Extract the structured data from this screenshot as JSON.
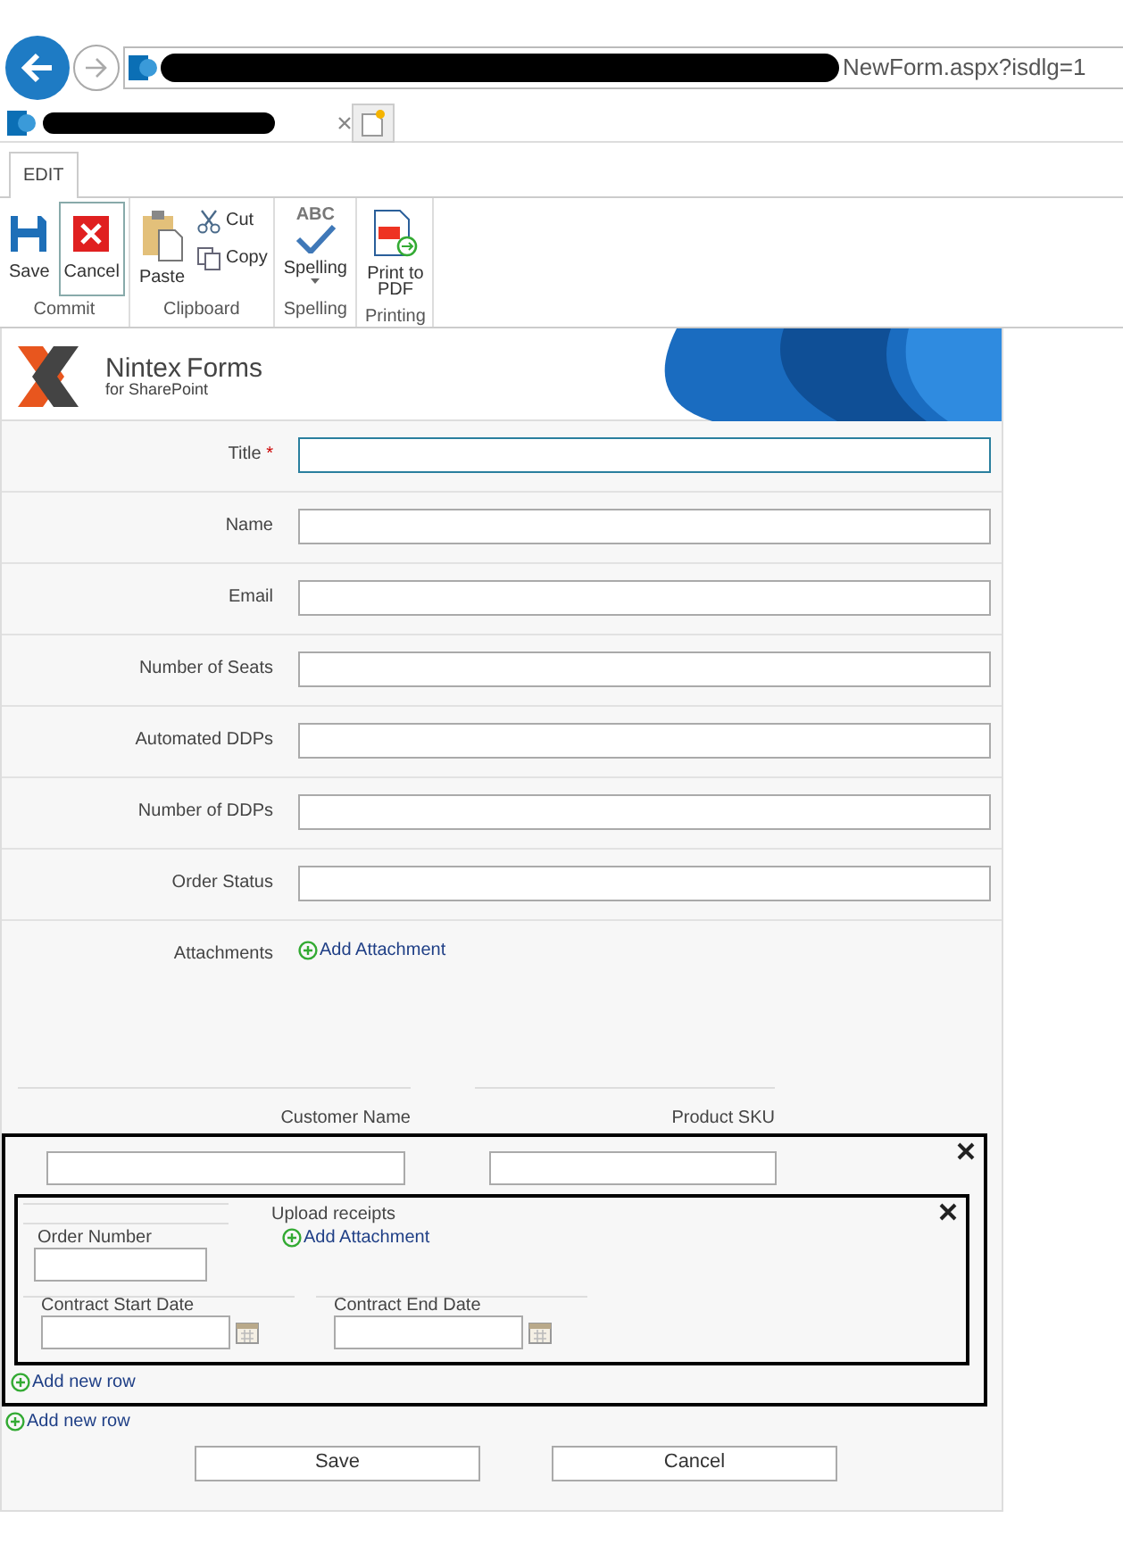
{
  "address_bar": {
    "url": "NewForm.aspx?isdlg=1"
  },
  "ribbon": {
    "tabs": [
      {
        "label": "EDIT",
        "selected": true
      }
    ],
    "groups": [
      {
        "label": "Commit",
        "buttons": [
          {
            "kind": "save",
            "label": "Save",
            "selected": false
          },
          {
            "kind": "cancel",
            "label": "Cancel",
            "selected": true
          }
        ]
      },
      {
        "label": "Clipboard",
        "buttons": [
          {
            "kind": "paste",
            "label": "Paste",
            "selected": false
          },
          {
            "kind": "cut",
            "label": "Cut",
            "selected": false
          },
          {
            "kind": "copy",
            "label": "Copy",
            "selected": false
          }
        ]
      },
      {
        "label": "Spelling",
        "buttons": [
          {
            "kind": "spelling",
            "label": "Spelling",
            "caption": "ABC",
            "selected": false
          }
        ]
      },
      {
        "label": "Printing",
        "buttons": [
          {
            "kind": "pdf",
            "label": "Print to PDF",
            "selected": false
          }
        ]
      }
    ]
  },
  "form": {
    "required_mark": "*",
    "logo": {
      "brand": "Nintex",
      "product": "Forms",
      "subtitle": "for SharePoint"
    },
    "fields": [
      {
        "label": "Title",
        "required": true,
        "kind": "text",
        "focused": true
      },
      {
        "label": "Name",
        "required": false,
        "kind": "text",
        "focused": false
      },
      {
        "label": "Email",
        "required": false,
        "kind": "text",
        "focused": false
      },
      {
        "label": "Number of Seats",
        "required": false,
        "kind": "text",
        "focused": false
      },
      {
        "label": "Automated DDPs",
        "required": false,
        "kind": "text",
        "focused": false
      },
      {
        "label": "Number of DDPs",
        "required": false,
        "kind": "text",
        "focused": false
      },
      {
        "label": "Order Status",
        "required": false,
        "kind": "text",
        "focused": false
      },
      {
        "label": "Attachments",
        "required": false,
        "kind": "attachment",
        "link": "Add Attachment"
      }
    ],
    "repeating_section": {
      "headers": [
        "Customer Name",
        "Product SKU"
      ],
      "inner_section": {
        "upload_label": "Upload receipts",
        "upload_link": "Add Attachment",
        "order_label": "Order Number",
        "start_label": "Contract Start Date",
        "end_label": "Contract End Date"
      },
      "inner_add_row": "Add new row",
      "outer_add_row": "Add new row"
    },
    "buttons": [
      "Save",
      "Cancel"
    ]
  }
}
